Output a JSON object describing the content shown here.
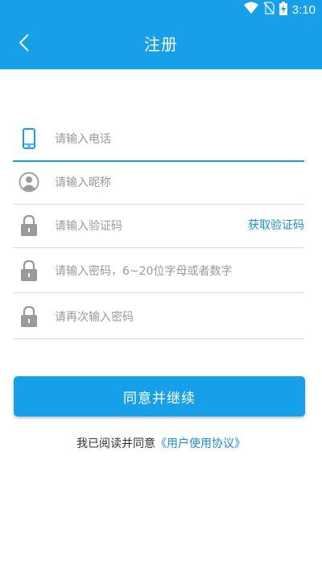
{
  "status_bar": {
    "time": "3:10",
    "icons": [
      "wifi-icon",
      "no-sim-icon",
      "battery-charging-icon"
    ]
  },
  "header": {
    "title": "注册",
    "back_icon": "chevron-left-icon"
  },
  "form": {
    "phone": {
      "placeholder": "请输入电话",
      "icon": "phone-icon"
    },
    "nickname": {
      "placeholder": "请输入昵称",
      "icon": "user-avatar-icon"
    },
    "code": {
      "placeholder": "请输入验证码",
      "icon": "lock-icon",
      "get_code_label": "获取验证码"
    },
    "password": {
      "placeholder": "请输入密码，6~20位字母或者数字",
      "icon": "lock-icon"
    },
    "confirm_password": {
      "placeholder": "请再次输入密码",
      "icon": "lock-icon"
    }
  },
  "submit_label": "同意并继续",
  "agreement": {
    "prefix": "我已阅读并同意",
    "link": "《用户使用协议》"
  },
  "colors": {
    "primary": "#17a0ea",
    "link": "#1a8fd8",
    "icon_gray": "#9a9a9a"
  }
}
